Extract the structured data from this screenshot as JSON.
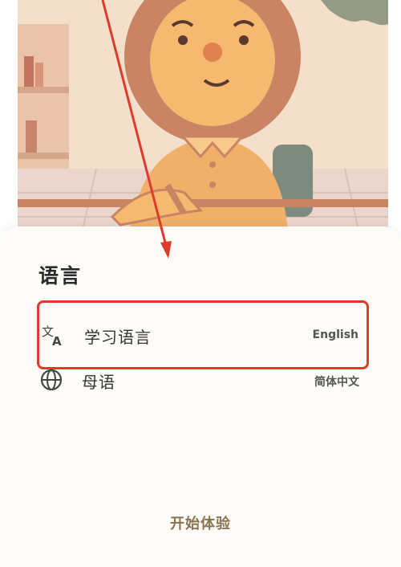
{
  "sheet": {
    "title": "语言",
    "rows": [
      {
        "label": "学习语言",
        "value": "English",
        "icon": "translate-icon"
      },
      {
        "label": "母语",
        "value": "简体中文",
        "icon": "globe-icon"
      }
    ],
    "start_label": "开始体验"
  },
  "colors": {
    "highlight": "#e03a2c",
    "start_text": "#8a7350",
    "sheet_bg": "#fdfcf8"
  }
}
